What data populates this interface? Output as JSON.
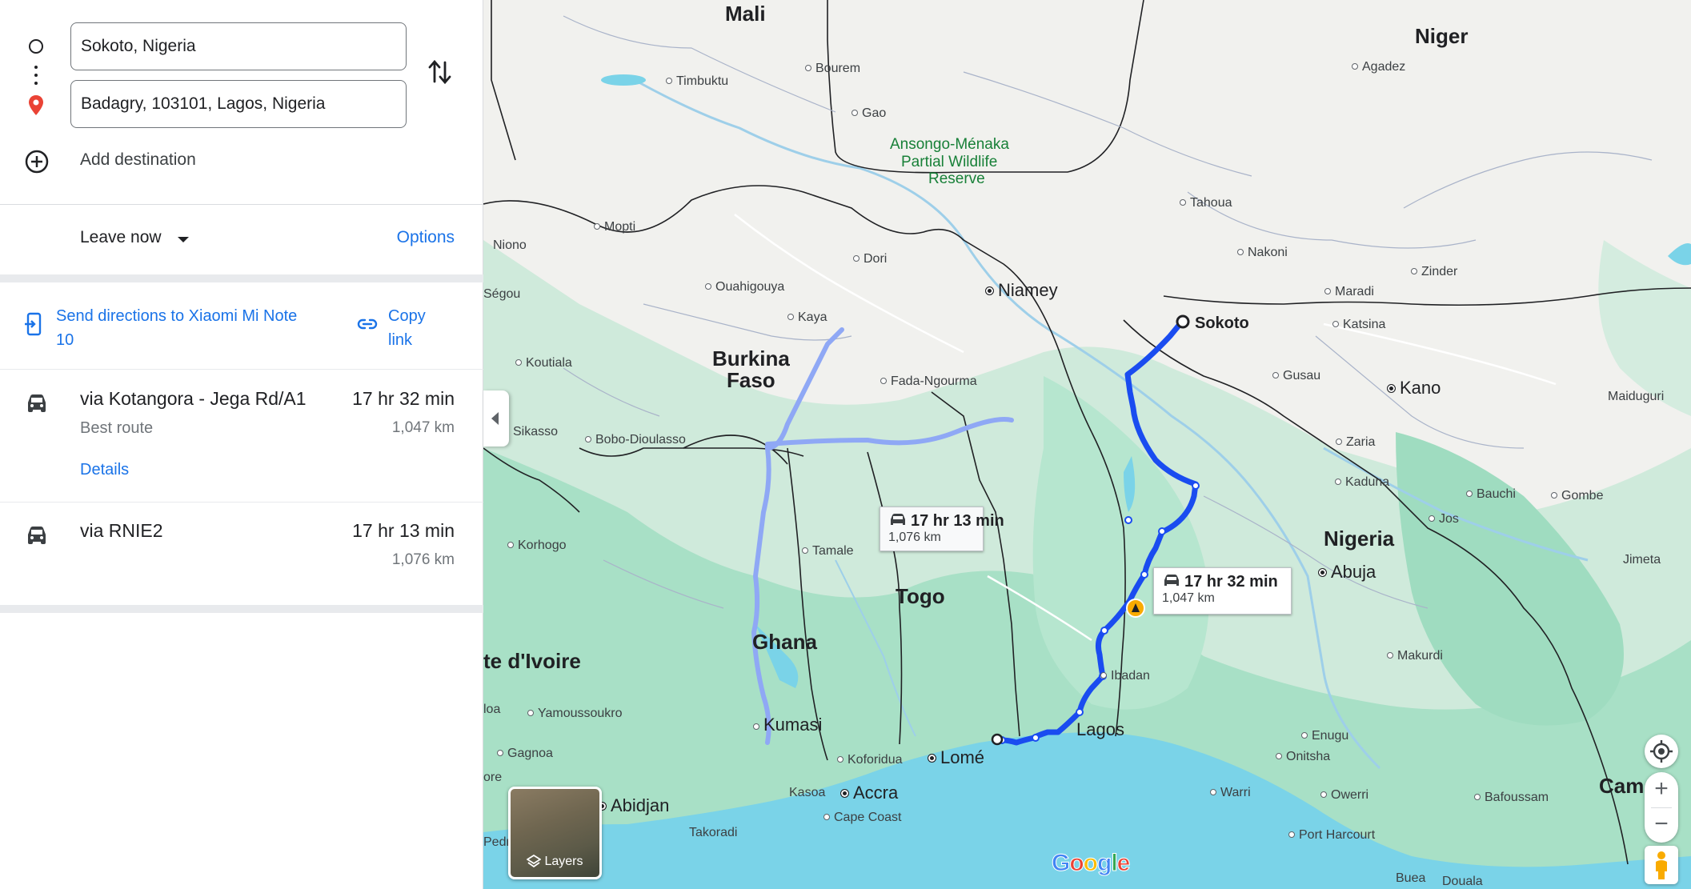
{
  "directions": {
    "origin": "Sokoto, Nigeria",
    "destination": "Badagry, 103101, Lagos, Nigeria",
    "add_destination": "Add destination",
    "origin_icon": "circle-origin-icon",
    "destination_icon": "red-pin-icon",
    "swap_icon": "swap-vertical-icon"
  },
  "departure": {
    "leave_label": "Leave now",
    "options_label": "Options"
  },
  "share": {
    "send_label": "Send directions to Xiaomi Mi Note 10",
    "copy_label": "Copy link"
  },
  "routes": [
    {
      "via": "via Kotangora - Jega Rd/A1",
      "time": "17 hr 32 min",
      "sub": "Best route",
      "distance": "1,047 km",
      "details": "Details",
      "icon": "car-icon"
    },
    {
      "via": "via RNIE2",
      "time": "17 hr 13 min",
      "distance": "1,076 km",
      "icon": "car-icon"
    }
  ],
  "map": {
    "callouts": [
      {
        "time": "17 hr 13 min",
        "distance": "1,076 km"
      },
      {
        "time": "17 hr 32 min",
        "distance": "1,047 km"
      }
    ],
    "countries": {
      "mali": "Mali",
      "niger": "Niger",
      "burkina1": "Burkina",
      "burkina2": "Faso",
      "togo": "Togo",
      "ghana": "Ghana",
      "nigeria": "Nigeria",
      "ivoire": "te d'Ivoire",
      "cam": "Cam"
    },
    "reserve": [
      "Ansongo-Ménaka",
      "Partial Wildlife",
      "Reserve"
    ],
    "places": {
      "timbuktu": "Timbuktu",
      "bourem": "Bourem",
      "gao": "Gao",
      "agadez": "Agadez",
      "tahoua": "Tahoua",
      "mopti": "Mopti",
      "niono": "Niono",
      "nakoni": "Nakoni",
      "zinder": "Zinder",
      "maradi": "Maradi",
      "dori": "Dori",
      "ouahigouya": "Ouahigouya",
      "niamey": "Niamey",
      "sokoto": "Sokoto",
      "katsina": "Katsina",
      "segou": "Ségou",
      "kaya": "Kaya",
      "koutiala": "Koutiala",
      "gusau": "Gusau",
      "kano": "Kano",
      "fada": "Fada-Ngourma",
      "maiduguri": "Maiduguri",
      "sikasso": "Sikasso",
      "bobo": "Bobo-Dioulasso",
      "zaria": "Zaria",
      "kaduna": "Kaduna",
      "bauchi": "Bauchi",
      "gombe": "Gombe",
      "korhogo": "Korhogo",
      "tamale": "Tamale",
      "jos": "Jos",
      "abuja": "Abuja",
      "jimeta": "Jimeta",
      "makurdi": "Makurdi",
      "ibadan": "Ibadan",
      "yamoussoukro": "Yamoussoukro",
      "kumasi": "Kumasi",
      "lagos": "Lagos",
      "gagnoa": "Gagnoa",
      "koforidua": "Koforidua",
      "lome": "Lomé",
      "enugu": "Enugu",
      "onitsha": "Onitsha",
      "abidjan": "Abidjan",
      "kasoa": "Kasoa",
      "accra": "Accra",
      "warri": "Warri",
      "owerri": "Owerri",
      "bafoussam": "Bafoussam",
      "capecoast": "Cape Coast",
      "takoradi": "Takoradi",
      "portharcourt": "Port Harcourt",
      "buea": "Buea",
      "douala": "Douala",
      "pedr": "Pedr",
      "ore": "ore",
      "loa": "loa"
    },
    "layers_label": "Layers",
    "zoom_in": "+",
    "zoom_out": "−",
    "logo": [
      "G",
      "o",
      "o",
      "g",
      "l",
      "e"
    ],
    "colors": {
      "route_primary": "#1a4cf0",
      "route_alt": "#8fa8f5",
      "water": "#7ad3e8",
      "green": "#a8e0c6",
      "land": "#f1f1ee"
    }
  }
}
